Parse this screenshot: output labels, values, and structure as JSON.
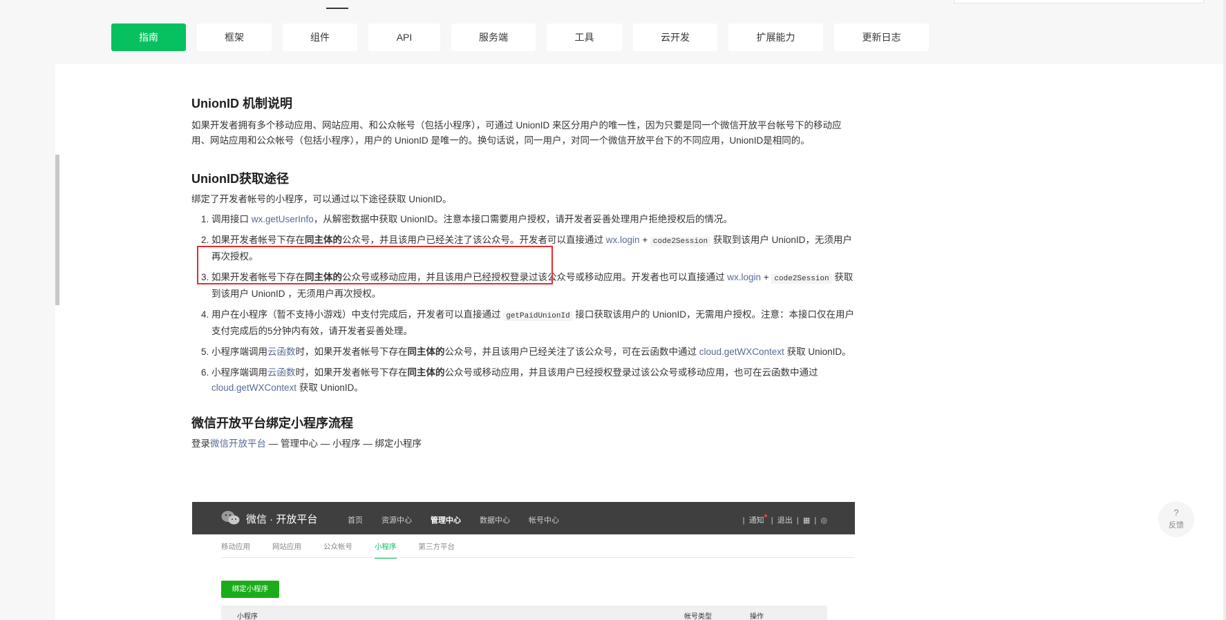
{
  "nav": {
    "tabs": [
      {
        "label": "指南",
        "active": true
      },
      {
        "label": "框架"
      },
      {
        "label": "组件"
      },
      {
        "label": "API"
      },
      {
        "label": "服务端"
      },
      {
        "label": "工具"
      },
      {
        "label": "云开发"
      },
      {
        "label": "扩展能力"
      },
      {
        "label": "更新日志"
      }
    ]
  },
  "section1": {
    "title": "UnionID 机制说明",
    "body": "如果开发者拥有多个移动应用、网站应用、和公众帐号（包括小程序），可通过 UnionID 来区分用户的唯一性，因为只要是同一个微信开放平台帐号下的移动应用、网站应用和公众帐号（包括小程序），用户的 UnionID 是唯一的。换句话说，同一用户，对同一个微信开放平台下的不同应用，UnionID是相同的。"
  },
  "section2": {
    "title": "UnionID获取途径",
    "intro": "绑定了开发者帐号的小程序，可以通过以下途径获取 UnionID。",
    "items": {
      "i1": {
        "a": "调用接口 ",
        "link": "wx.getUserInfo",
        "b": "，从解密数据中获取 UnionID。注意本接口需要用户授权，请开发者妥善处理用户拒绝授权后的情况。"
      },
      "i2": {
        "a": "如果开发者帐号下存在",
        "bold": "同主体的",
        "b": "公众号，并且该用户已经关注了该公众号。开发者可以直接通过 ",
        "link": "wx.login",
        "c": " + ",
        "code": "code2Session",
        "d": " 获取到该用户 UnionID，无须用户再次授权。"
      },
      "i3": {
        "a": "如果开发者帐号下存在",
        "bold": "同主体的",
        "b": "公众号或移动应用，并且该用户已经授权登录过该公众号或移动应用。开发者也可以直接通过 ",
        "link": "wx.login",
        "c": " + ",
        "code": "code2Session",
        "d": " 获取到该用户 UnionID ，无须用户再次授权。"
      },
      "i4": {
        "a": "用户在小程序（暂不支持小游戏）中支付完成后，开发者可以直接通过 ",
        "code": "getPaidUnionId",
        "b": " 接口获取该用户的 UnionID，无需用户授权。注意：本接口仅在用户支付完成后的5分钟内有效，请开发者妥善处理。"
      },
      "i5": {
        "a": "小程序端调用",
        "link1": "云函数",
        "b": "时，如果开发者帐号下存在",
        "bold": "同主体的",
        "c": "公众号，并且该用户已经关注了该公众号，可在云函数中通过 ",
        "link2": "cloud.getWXContext",
        "d": " 获取 UnionID。"
      },
      "i6": {
        "a": "小程序端调用",
        "link1": "云函数",
        "b": "时，如果开发者帐号下存在",
        "bold": "同主体的",
        "c": "公众号或移动应用，并且该用户已经授权登录过该公众号或移动应用，也可在云函数中通过 ",
        "link2": "cloud.getWXContext",
        "d": " 获取 UnionID。"
      }
    }
  },
  "section3": {
    "title": "微信开放平台绑定小程序流程",
    "a": "登录",
    "link": "微信开放平台",
    "b": " — 管理中心 — 小程序 — 绑定小程序"
  },
  "screenshot": {
    "brand": "微信 · 开放平台",
    "nav": [
      "首页",
      "资源中心",
      "管理中心",
      "数据中心",
      "帐号中心"
    ],
    "right": {
      "notice": "通知",
      "logout": "退出",
      "sep": "|"
    },
    "subnav": [
      "移动应用",
      "网站应用",
      "公众帐号",
      "小程序",
      "第三方平台"
    ],
    "bind_button": "绑定小程序",
    "table_headers": [
      "小程序",
      "帐号类型",
      "操作"
    ]
  },
  "feedback": {
    "q": "?",
    "label": "反馈"
  },
  "colors": {
    "accent": "#07c160",
    "link": "#576b95",
    "highlight": "#e42b2b"
  }
}
